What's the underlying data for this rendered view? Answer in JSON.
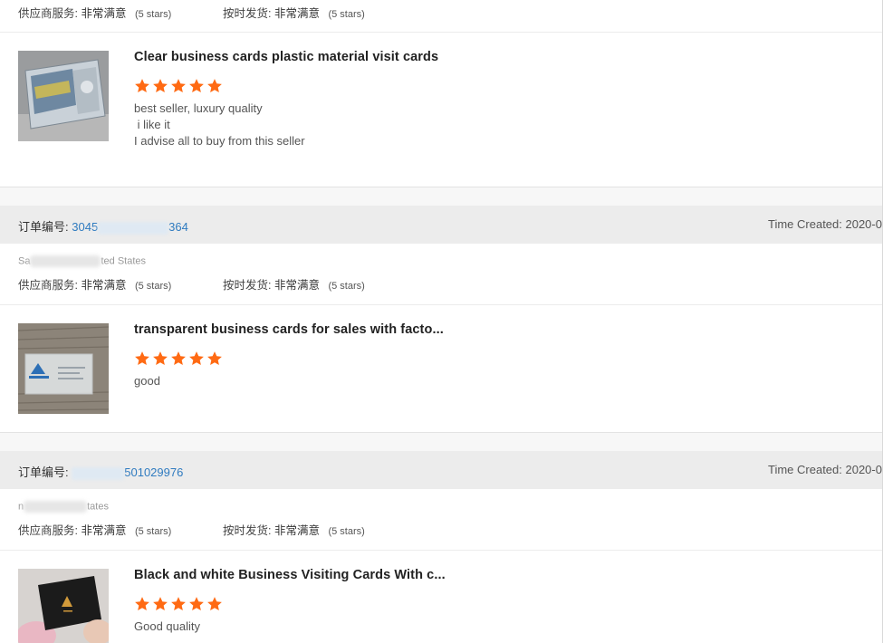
{
  "feedback_items": [
    {
      "supplier_service_label": "供应商服务:",
      "supplier_service_value": "非常满意",
      "supplier_service_stars": "(5 stars)",
      "shipping_label": "按时发货:",
      "shipping_value": "非常满意",
      "shipping_stars": "(5 stars)",
      "product_title": "Clear business cards plastic material visit cards",
      "rating": 5,
      "review": "best seller, luxury quality\n i like it\nI advise all to buy from this seller"
    },
    {
      "order_label": "订单编号:",
      "order_number_start": "3045",
      "order_number_end": "364",
      "time_created": "Time Created: 2020-0",
      "buyer_start": "Sa",
      "buyer_end": "ted States",
      "supplier_service_label": "供应商服务:",
      "supplier_service_value": "非常满意",
      "supplier_service_stars": "(5 stars)",
      "shipping_label": "按时发货:",
      "shipping_value": "非常满意",
      "shipping_stars": "(5 stars)",
      "product_title": "transparent business cards for sales with facto...",
      "rating": 5,
      "review": "good"
    },
    {
      "order_label": "订单编号:",
      "order_number_end": "501029976",
      "time_created": "Time Created: 2020-0",
      "buyer_start": "n",
      "buyer_end": "tates",
      "supplier_service_label": "供应商服务:",
      "supplier_service_value": "非常满意",
      "supplier_service_stars": "(5 stars)",
      "shipping_label": "按时发货:",
      "shipping_value": "非常满意",
      "shipping_stars": "(5 stars)",
      "product_title": "Black and white Business Visiting Cards With c...",
      "rating": 5,
      "review": "Good quality"
    }
  ],
  "colors": {
    "star": "#ff6a13",
    "link": "#2f7bc0",
    "header_bg": "#ececec"
  }
}
